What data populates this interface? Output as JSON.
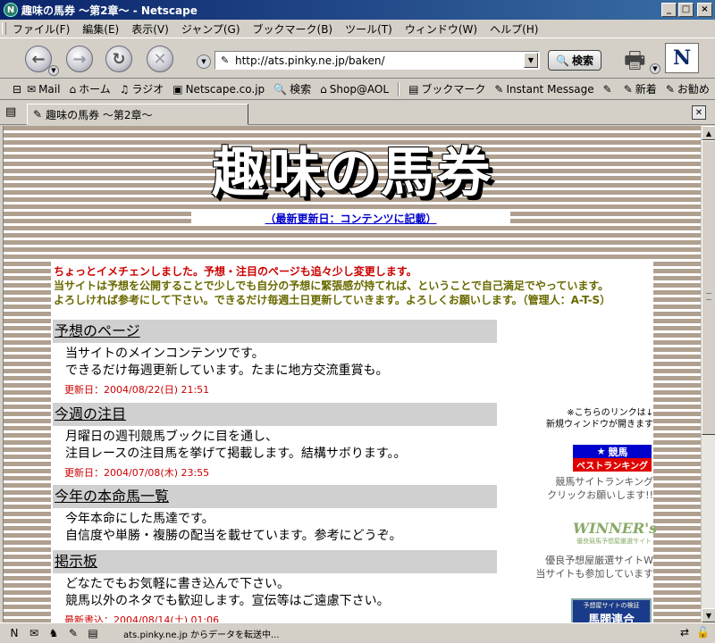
{
  "window": {
    "app_icon_letter": "N",
    "title": "趣味の馬券 ～第2章～ - Netscape",
    "minimize": "_",
    "maximize": "□",
    "close": "×"
  },
  "menu": [
    "ファイル(F)",
    "編集(E)",
    "表示(V)",
    "ジャンプ(G)",
    "ブックマーク(B)",
    "ツール(T)",
    "ウィンドウ(W)",
    "ヘルプ(H)"
  ],
  "nav": {
    "back_glyph": "←",
    "forward_glyph": "→",
    "reload_glyph": "↻",
    "stop_glyph": "✕",
    "url": "http://ats.pinky.ne.jp/baken/",
    "search_label": "検索",
    "logo_letter": "N"
  },
  "personal_toolbar": [
    {
      "icon": "mail-icon",
      "label": "Mail"
    },
    {
      "icon": "home-icon",
      "label": "ホーム"
    },
    {
      "icon": "radio-icon",
      "label": "ラジオ"
    },
    {
      "icon": "my-netscape-icon",
      "label": "Netscape.co.jp"
    },
    {
      "icon": "search-icon",
      "label": "検索"
    },
    {
      "icon": "shop-icon",
      "label": "Shop@AOL"
    },
    {
      "icon": "bookmark-icon",
      "label": "ブックマーク"
    },
    {
      "icon": "bookmark-link-icon",
      "label": "Instant Message"
    },
    {
      "icon": "bookmark-link-icon",
      "label": ""
    },
    {
      "icon": "bookmark-link-icon",
      "label": "新着"
    },
    {
      "icon": "bookmark-link-icon",
      "label": "お勧め"
    }
  ],
  "tab": {
    "label": "趣味の馬券 ～第2章～"
  },
  "page": {
    "site_title": "趣味の馬券",
    "updated_link": "（最新更新日：コンテンツに記載）",
    "notice_line1": "ちょっとイメチェンしました。予想・注目のページも追々少し変更します。",
    "notice_line2": "当サイトは予想を公開することで少しでも自分の予想に緊張感が持てれば、ということで自己満足でやっています。",
    "notice_line3": "よろしければ参考にして下さい。できるだけ毎週土日更新していきます。よろしくお願いします。（管理人：A-T-S）",
    "sections": [
      {
        "title": "予想のページ",
        "lines": [
          "当サイトのメインコンテンツです。",
          "できるだけ毎週更新しています。たまに地方交流重賞も。"
        ],
        "date": "更新日：2004/08/22(日) 21:51"
      },
      {
        "title": "今週の注目",
        "lines": [
          "月曜日の週刊競馬ブックに目を通し、",
          "注目レースの注目馬を挙げて掲載します。結構サボります。。"
        ],
        "date": "更新日：2004/07/08(木) 23:55"
      },
      {
        "title": "今年の本命馬一覧",
        "lines": [
          "今年本命にした馬達です。",
          "自信度や単勝・複勝の配当を載せています。参考にどうぞ。"
        ],
        "date": ""
      },
      {
        "title": "掲示板",
        "lines": [
          "どなたでもお気軽に書き込んで下さい。",
          "競馬以外のネタでも歓迎します。宣伝等はご遠慮下さい。"
        ],
        "date": "最新書込：2004/08/14(土) 01:06"
      }
    ],
    "side_note_line1": "※こちらのリンクは↓",
    "side_note_line2": "新規ウィンドウが開きます",
    "banner1_top": "競馬",
    "banner1_bottom": "ベストランキング",
    "side_text1_line1": "競馬サイトランキング",
    "side_text1_line2": "クリックお願いします!!",
    "banner2_big": "WINNER's",
    "banner2_small": "優良競馬予想屋厳選サイト",
    "side_text2_line1": "優良予想屋厳選サイトW",
    "side_text2_line2": "当サイトも参加しています",
    "banner3_small": "予想屋サイトの検証",
    "banner3_big": "馬閥連合"
  },
  "status": {
    "text": "ats.pinky.ne.jp からデータを転送中..."
  }
}
